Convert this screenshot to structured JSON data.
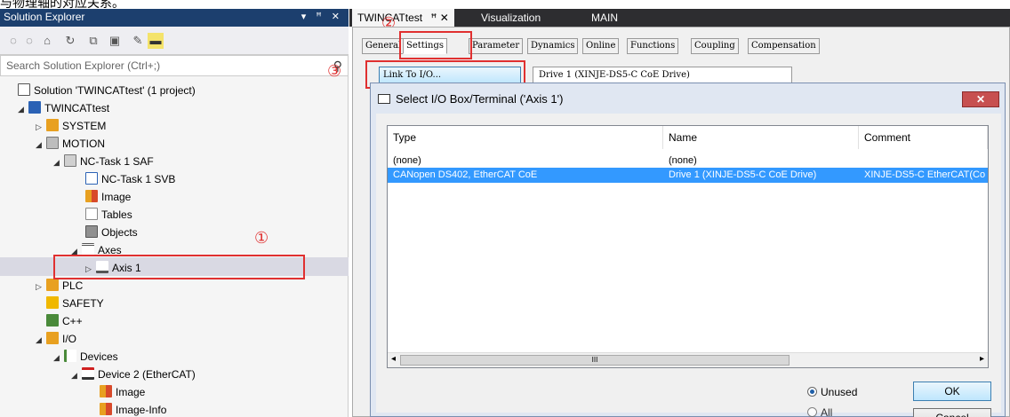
{
  "top_caption": "与物理轴的对应关系。",
  "explorer": {
    "title": "Solution Explorer",
    "title_controls": "▾ ꟸ ✕",
    "search_placeholder": "Search Solution Explorer (Ctrl+;)",
    "tree": [
      {
        "label": "Solution 'TWINCATtest' (1 project)",
        "icon": "solution-icon",
        "color": "#4a4a4a"
      },
      {
        "label": "TWINCATtest",
        "icon": "project-icon",
        "color": "#2b62b5"
      },
      {
        "label": "SYSTEM",
        "icon": "system-gear-icon",
        "color": "#e8a020"
      },
      {
        "label": "MOTION",
        "icon": "motion-icon",
        "color": "#7a7a7a"
      },
      {
        "label": "NC-Task 1 SAF",
        "icon": "task-icon",
        "color": "#7a7a7a"
      },
      {
        "label": "NC-Task 1 SVB",
        "icon": "task-doc-icon",
        "color": "#2b62b5"
      },
      {
        "label": "Image",
        "icon": "image-icon",
        "color": "#d84a2a"
      },
      {
        "label": "Tables",
        "icon": "table-icon",
        "color": "#8a8a8a"
      },
      {
        "label": "Objects",
        "icon": "objects-icon",
        "color": "#606060"
      },
      {
        "label": "Axes",
        "icon": "axes-icon",
        "color": "#505050"
      },
      {
        "label": "Axis 1",
        "icon": "axis-icon",
        "color": "#505050"
      },
      {
        "label": "PLC",
        "icon": "plc-icon",
        "color": "#e8a020"
      },
      {
        "label": "SAFETY",
        "icon": "safety-icon",
        "color": "#f0b800"
      },
      {
        "label": "C++",
        "icon": "cpp-icon",
        "color": "#4a8a3a"
      },
      {
        "label": "I/O",
        "icon": "io-icon",
        "color": "#e8a020"
      },
      {
        "label": "Devices",
        "icon": "devices-icon",
        "color": "#505050"
      },
      {
        "label": "Device 2 (EtherCAT)",
        "icon": "ethercat-icon",
        "color": "#d02020"
      },
      {
        "label": "Image",
        "icon": "image-icon",
        "color": "#d84a2a"
      },
      {
        "label": "Image-Info",
        "icon": "image-icon",
        "color": "#d84a2a"
      }
    ],
    "annotation_1": "①"
  },
  "editor": {
    "tabs": {
      "active": "TWINCATtest",
      "pin": "ꟸ ✕",
      "other1": "Visualization",
      "other2": "MAIN"
    },
    "annotation_2": "②",
    "annotation_3": "③",
    "settings_tabs": [
      "General",
      "Settings",
      "Parameter",
      "Dynamics",
      "Online",
      "Functions",
      "Coupling",
      "Compensation"
    ],
    "link_button": "Link To I/O...",
    "drive_value": "Drive 1 (XINJE-DS5-C CoE Drive)"
  },
  "dialog": {
    "title": "Select I/O Box/Terminal ('Axis 1')",
    "close": "✕",
    "columns": [
      "Type",
      "Name",
      "Comment"
    ],
    "rows": [
      {
        "type": "(none)",
        "name": "(none)",
        "comment": ""
      },
      {
        "type": "CANopen DS402, EtherCAT CoE",
        "name": "Drive 1 (XINJE-DS5-C CoE Drive)",
        "comment": "XINJE-DS5-C EtherCAT(Co"
      }
    ],
    "scroll_left": "◂",
    "scroll_right": "▸",
    "scroll_thumb": "III",
    "radio_unused": "Unused",
    "radio_all": "All",
    "ok": "OK",
    "cancel": "Cancel"
  },
  "colors": {
    "selection": "#3399ff",
    "annotation_red": "#e03030",
    "title_bar": "#1c3f6e"
  }
}
